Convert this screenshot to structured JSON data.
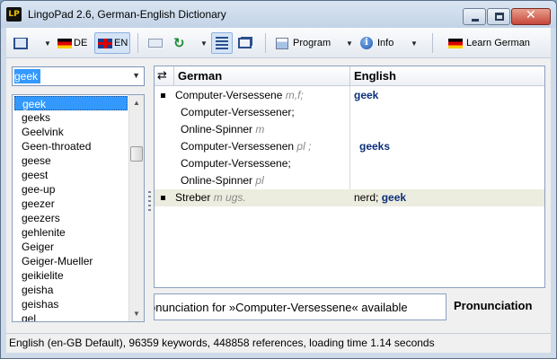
{
  "window": {
    "title": "LingoPad 2.6, German-English Dictionary",
    "logo_text": "LP"
  },
  "toolbar": {
    "lang_de_label": "DE",
    "lang_en_label": "EN",
    "program_label": "Program",
    "info_label": "Info",
    "learn_label": "Learn German"
  },
  "search": {
    "value": "geek"
  },
  "wordlist": {
    "selected": "geek",
    "items": [
      "geek",
      "geeks",
      "Geelvink",
      "Geen-throated",
      "geese",
      "geest",
      "gee-up",
      "geezer",
      "geezers",
      "gehlenite",
      "Geiger",
      "Geiger-Mueller",
      "geikielite",
      "geisha",
      "geishas",
      "gel"
    ]
  },
  "results": {
    "swap_symbol": "⇄",
    "col_german": "German",
    "col_english": "English",
    "rows": [
      {
        "de": "Computer-Versessene",
        "gram": "m,f;",
        "en_bold": "geek",
        "en_plain": ""
      },
      {
        "de": "Computer-Versessener;",
        "gram": "",
        "en_bold": "",
        "en_plain": ""
      },
      {
        "de": "Online-Spinner",
        "gram": "m",
        "en_bold": "",
        "en_plain": ""
      },
      {
        "de": "Computer-Versessenen",
        "gram": "pl ;",
        "en_bold": "geeks",
        "en_plain": ""
      },
      {
        "de": "Computer-Versessene;",
        "gram": "",
        "en_bold": "",
        "en_plain": ""
      },
      {
        "de": "Online-Spinner",
        "gram": "pl",
        "en_bold": "",
        "en_plain": ""
      },
      {
        "de": "Streber",
        "gram": "m  ugs.",
        "en_bold": "geek",
        "en_plain": "nerd; "
      }
    ]
  },
  "pronunciation": {
    "field_text": "onunciation for »Computer-Versessene« available",
    "button_label": "Pronunciation"
  },
  "status": {
    "text": "English (en-GB Default), 96359 keywords, 448858 references, loading time 1.14 seconds"
  },
  "colors": {
    "selection": "#3399ff",
    "english_term": "#0b2f7a",
    "shaded_row": "#ececdf"
  }
}
